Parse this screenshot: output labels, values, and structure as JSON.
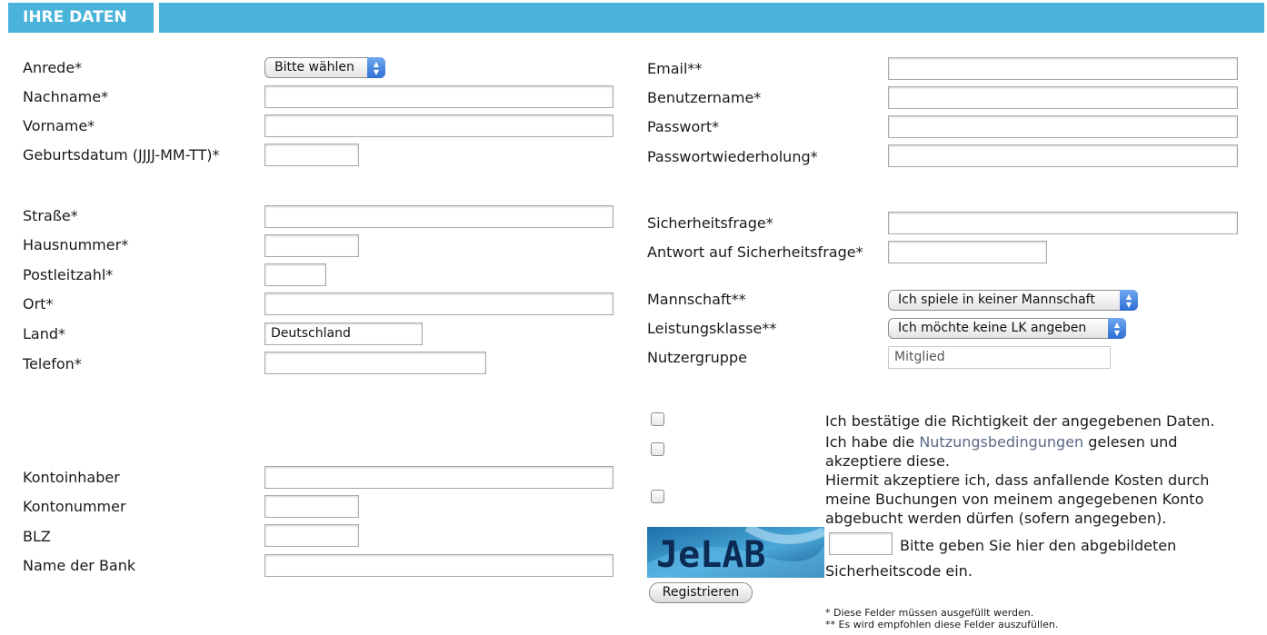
{
  "header": {
    "title": "IHRE DATEN"
  },
  "personal": {
    "anrede": {
      "label": "Anrede*",
      "value": "Bitte wählen"
    },
    "nachname": {
      "label": "Nachname*",
      "value": ""
    },
    "vorname": {
      "label": "Vorname*",
      "value": ""
    },
    "geburtsdatum": {
      "label": "Geburtsdatum (JJJJ-MM-TT)*",
      "value": ""
    }
  },
  "address": {
    "strasse": {
      "label": "Straße*",
      "value": ""
    },
    "hausnummer": {
      "label": "Hausnummer*",
      "value": ""
    },
    "plz": {
      "label": "Postleitzahl*",
      "value": ""
    },
    "ort": {
      "label": "Ort*",
      "value": ""
    },
    "land": {
      "label": "Land*",
      "value": "Deutschland"
    },
    "telefon": {
      "label": "Telefon*",
      "value": ""
    }
  },
  "bank": {
    "kontoinhaber": {
      "label": "Kontoinhaber",
      "value": ""
    },
    "kontonummer": {
      "label": "Kontonummer",
      "value": ""
    },
    "blz": {
      "label": "BLZ",
      "value": ""
    },
    "bankname": {
      "label": "Name der Bank",
      "value": ""
    }
  },
  "account": {
    "email": {
      "label": "Email**",
      "value": ""
    },
    "benutzername": {
      "label": "Benutzername*",
      "value": ""
    },
    "passwort": {
      "label": "Passwort*",
      "value": ""
    },
    "passwortwdh": {
      "label": "Passwortwiederholung*",
      "value": ""
    },
    "sicherheitsfrage": {
      "label": "Sicherheitsfrage*",
      "value": ""
    },
    "antwort": {
      "label": "Antwort auf Sicherheitsfrage*",
      "value": ""
    },
    "mannschaft": {
      "label": "Mannschaft**",
      "value": "Ich spiele in keiner Mannschaft"
    },
    "leistungsklasse": {
      "label": "Leistungsklasse**",
      "value": "Ich möchte keine LK angeben"
    },
    "nutzergruppe": {
      "label": "Nutzergruppe",
      "value": "Mitglied"
    }
  },
  "consents": {
    "richtigkeit": "Ich bestätige die Richtigkeit der angegebenen Daten.",
    "nutzung_pre": "Ich habe die ",
    "nutzung_link": "Nutzungsbedingungen",
    "nutzung_post": " gelesen und akzeptiere diese.",
    "kosten": "Hiermit akzeptiere ich, dass anfallende Kosten durch meine Buchungen von meinem angegebenen Konto abgebucht werden dürfen (sofern angegeben)."
  },
  "captcha": {
    "image_text": "JeLAB",
    "value": "",
    "instruction_line1": "Bitte geben Sie hier den abgebildeten",
    "instruction_line2": "Sicherheitscode ein."
  },
  "submit_label": "Registrieren",
  "footnotes": {
    "required": "* Diese Felder müssen ausgefüllt werden.",
    "recommended": "** Es wird empfohlen diese Felder auszufüllen."
  },
  "colors": {
    "header": "#4ab3da",
    "select_arrow": "#2f6fd6",
    "link": "#5c6b8a"
  }
}
